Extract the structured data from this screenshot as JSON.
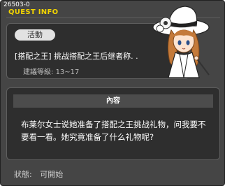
{
  "window": {
    "id_label": "26503-0",
    "title": "QUEST INFO"
  },
  "quest": {
    "category_badge": "活動",
    "name": "[搭配之王] 挑战搭配之王后继者称. .",
    "level_label": "建議等級:",
    "level_range": "13~17"
  },
  "content": {
    "header": "內容",
    "description": "布莱尔女士说她准备了搭配之王挑战礼物，问我要不要看一看。她究竟准备了什么礼物呢?"
  },
  "status": {
    "label": "狀態:",
    "value": "可開始"
  },
  "colors": {
    "title": "#f2d400",
    "window_bg": "#454545",
    "panel_bg": "#2e2e2e"
  },
  "icons": {
    "portrait": "npc-lady-portrait"
  }
}
